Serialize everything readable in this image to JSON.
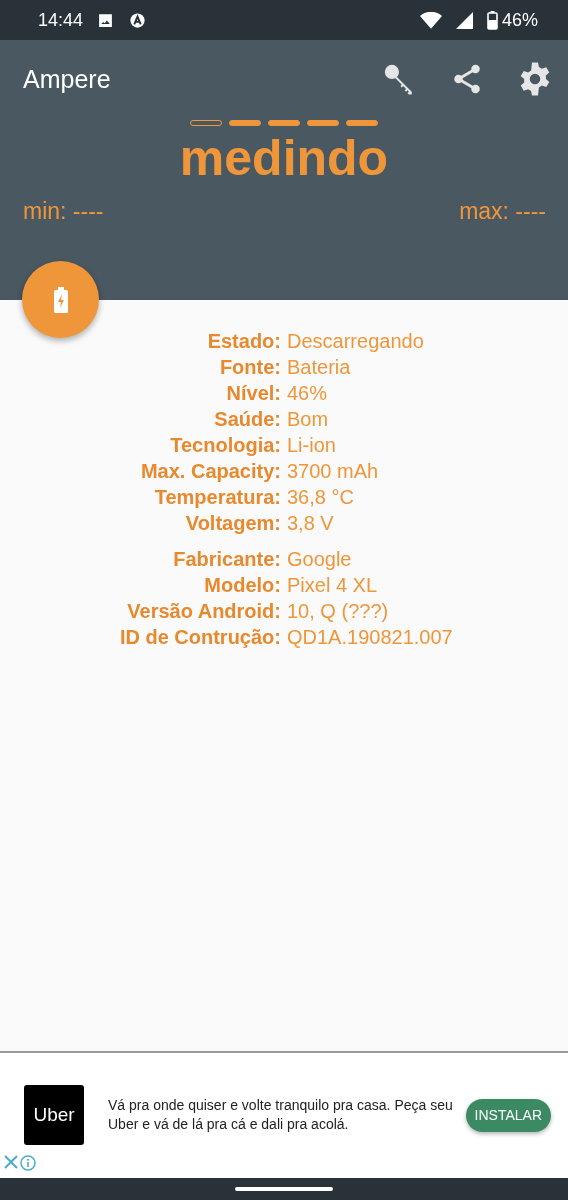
{
  "status_bar": {
    "time": "14:44",
    "battery": "46%"
  },
  "app_bar": {
    "title": "Ampere"
  },
  "indicator": [
    {
      "filled": false
    },
    {
      "filled": true
    },
    {
      "filled": true
    },
    {
      "filled": true
    },
    {
      "filled": true
    }
  ],
  "reading": "medindo",
  "min": "min: ----",
  "max": "max: ----",
  "info_groups": [
    [
      {
        "label": "Estado:",
        "value": "Descarregando"
      },
      {
        "label": "Fonte:",
        "value": "Bateria"
      },
      {
        "label": "Nível:",
        "value": "46%"
      },
      {
        "label": "Saúde:",
        "value": "Bom"
      },
      {
        "label": "Tecnologia:",
        "value": "Li-ion"
      },
      {
        "label": "Max. Capacity:",
        "value": "3700 mAh"
      },
      {
        "label": "Temperatura:",
        "value": "36,8 °C"
      },
      {
        "label": "Voltagem:",
        "value": "3,8 V"
      }
    ],
    [
      {
        "label": "Fabricante:",
        "value": "Google"
      },
      {
        "label": "Modelo:",
        "value": "Pixel 4 XL"
      },
      {
        "label": "Versão Android:",
        "value": "10, Q (???)"
      },
      {
        "label": "ID de Contrução:",
        "value": "QD1A.190821.007"
      }
    ]
  ],
  "ad": {
    "logo_text": "Uber",
    "text": "Vá pra onde quiser e volte tranquilo pra casa. Peça seu Uber e vá de lá pra cá e dali pra acolá.",
    "button": "INSTALAR"
  }
}
